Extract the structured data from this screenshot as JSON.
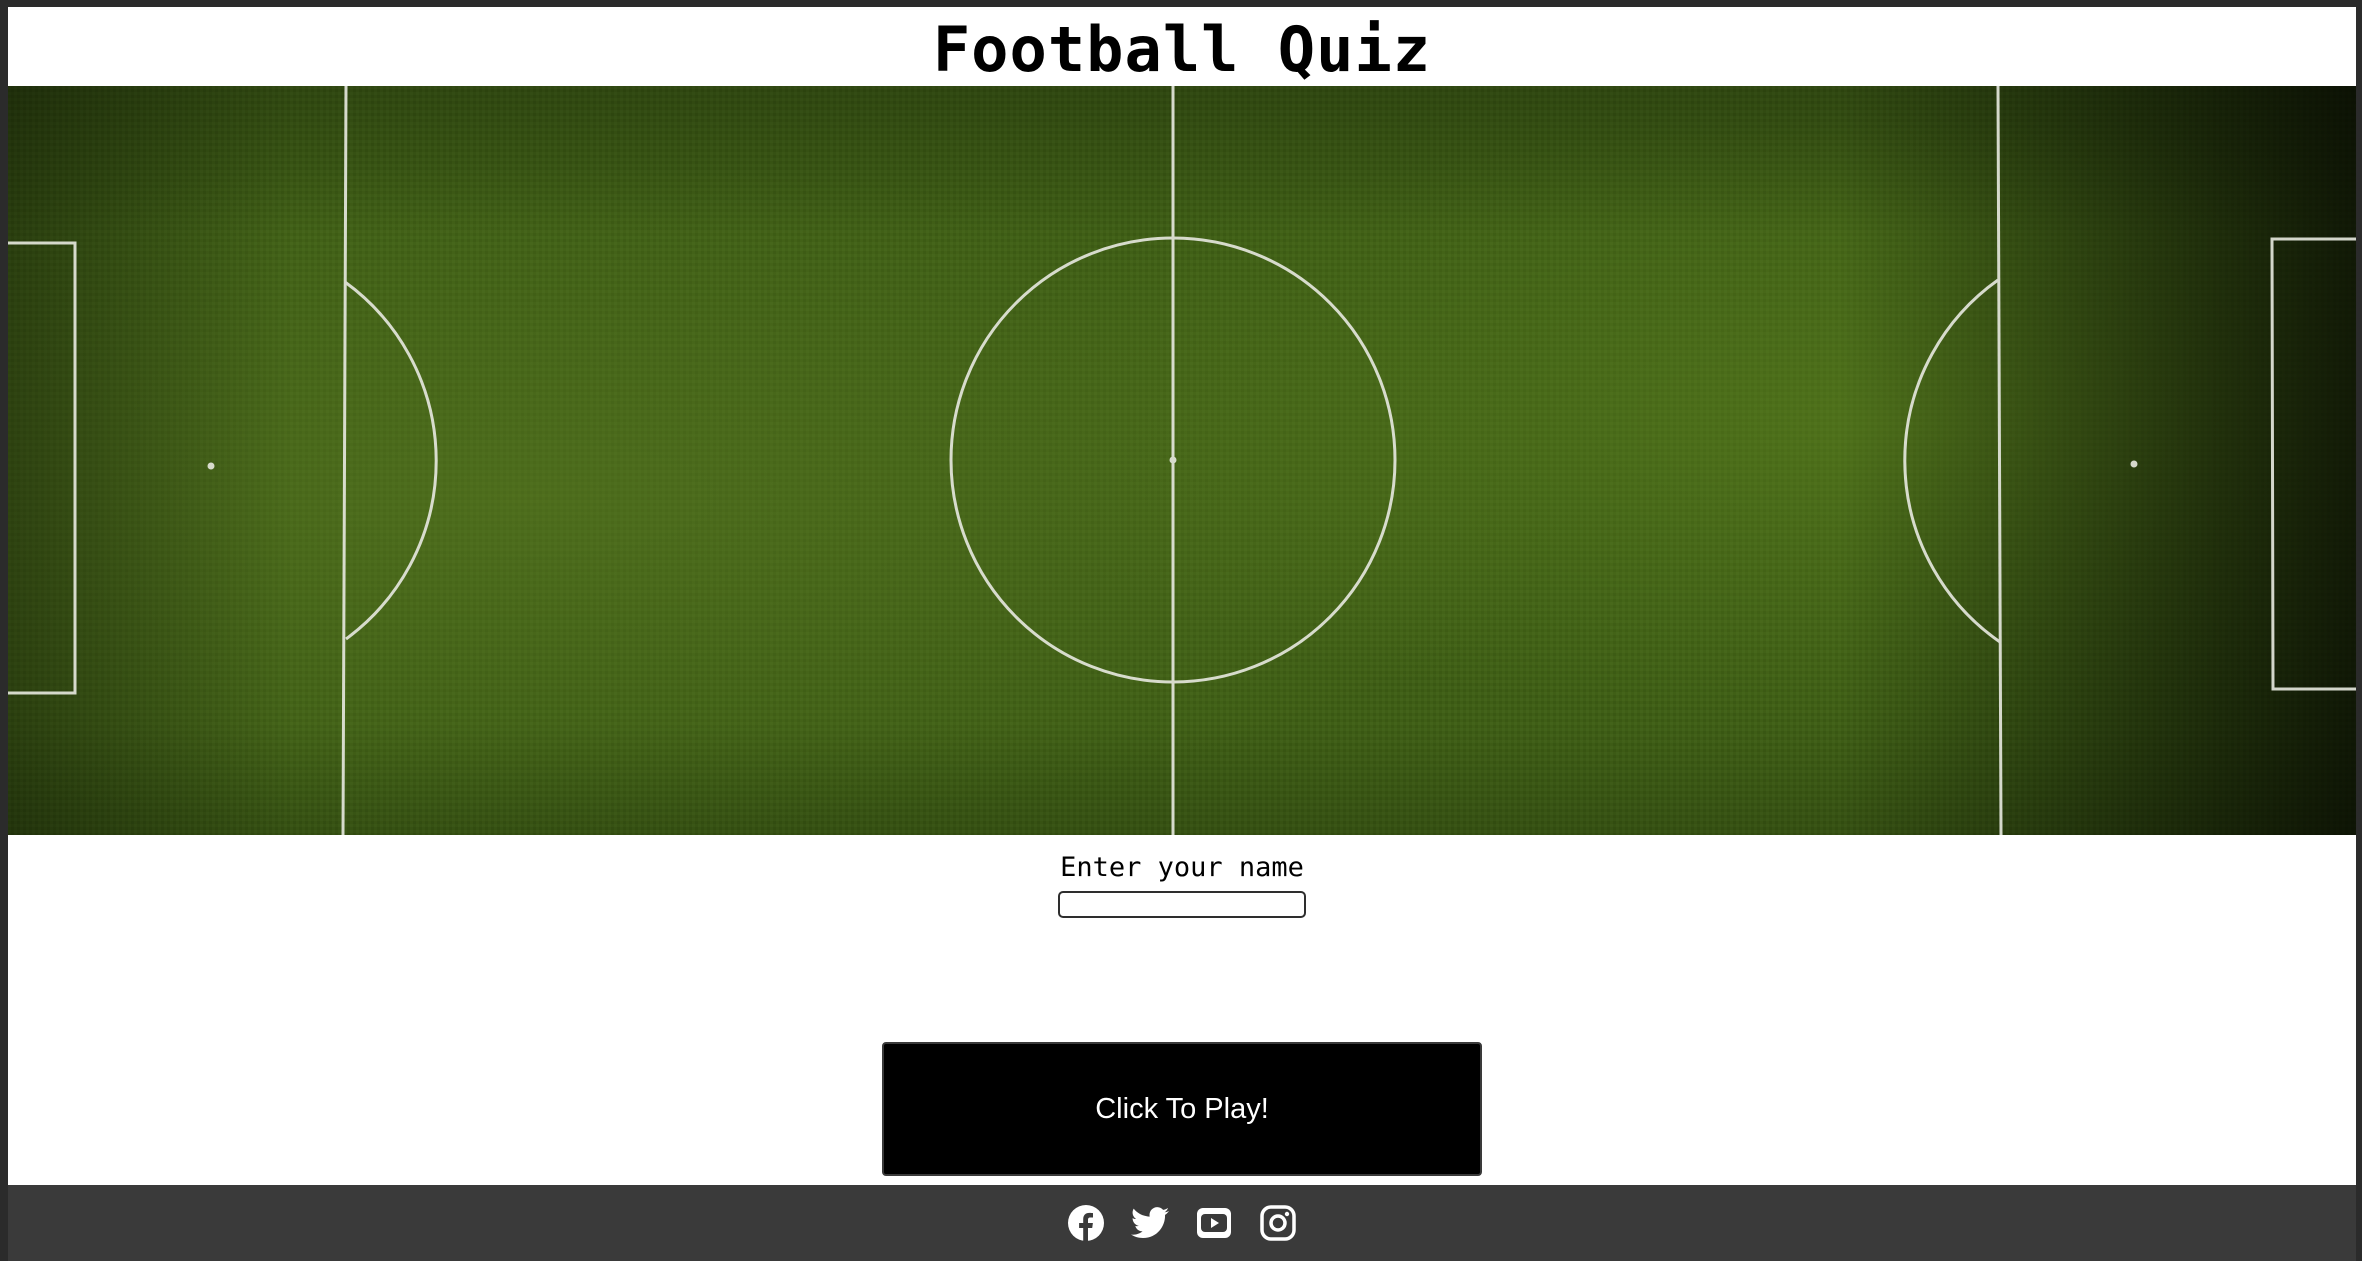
{
  "header": {
    "title": "Football Quiz"
  },
  "hero": {
    "image": "football-pitch-aerial",
    "pitch_color": "#3f5e16",
    "line_color": "#e8e8e0"
  },
  "form": {
    "name_label": "Enter your name",
    "name_value": "",
    "name_placeholder": ""
  },
  "actions": {
    "play_label": "Click To Play!"
  },
  "footer": {
    "background": "#3a3a3a",
    "social_icons": [
      "facebook-icon",
      "twitter-icon",
      "youtube-icon",
      "instagram-icon"
    ]
  }
}
